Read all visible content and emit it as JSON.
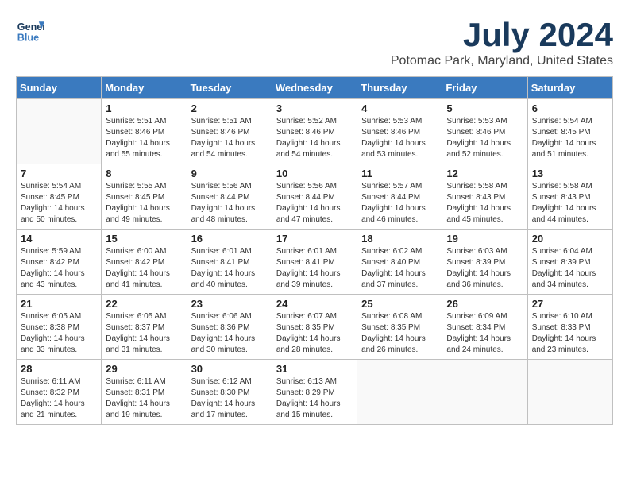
{
  "logo": {
    "line1": "General",
    "line2": "Blue"
  },
  "title": "July 2024",
  "subtitle": "Potomac Park, Maryland, United States",
  "days_of_week": [
    "Sunday",
    "Monday",
    "Tuesday",
    "Wednesday",
    "Thursday",
    "Friday",
    "Saturday"
  ],
  "weeks": [
    [
      {
        "day": "",
        "sunrise": "",
        "sunset": "",
        "daylight": ""
      },
      {
        "day": "1",
        "sunrise": "Sunrise: 5:51 AM",
        "sunset": "Sunset: 8:46 PM",
        "daylight": "Daylight: 14 hours and 55 minutes."
      },
      {
        "day": "2",
        "sunrise": "Sunrise: 5:51 AM",
        "sunset": "Sunset: 8:46 PM",
        "daylight": "Daylight: 14 hours and 54 minutes."
      },
      {
        "day": "3",
        "sunrise": "Sunrise: 5:52 AM",
        "sunset": "Sunset: 8:46 PM",
        "daylight": "Daylight: 14 hours and 54 minutes."
      },
      {
        "day": "4",
        "sunrise": "Sunrise: 5:53 AM",
        "sunset": "Sunset: 8:46 PM",
        "daylight": "Daylight: 14 hours and 53 minutes."
      },
      {
        "day": "5",
        "sunrise": "Sunrise: 5:53 AM",
        "sunset": "Sunset: 8:46 PM",
        "daylight": "Daylight: 14 hours and 52 minutes."
      },
      {
        "day": "6",
        "sunrise": "Sunrise: 5:54 AM",
        "sunset": "Sunset: 8:45 PM",
        "daylight": "Daylight: 14 hours and 51 minutes."
      }
    ],
    [
      {
        "day": "7",
        "sunrise": "Sunrise: 5:54 AM",
        "sunset": "Sunset: 8:45 PM",
        "daylight": "Daylight: 14 hours and 50 minutes."
      },
      {
        "day": "8",
        "sunrise": "Sunrise: 5:55 AM",
        "sunset": "Sunset: 8:45 PM",
        "daylight": "Daylight: 14 hours and 49 minutes."
      },
      {
        "day": "9",
        "sunrise": "Sunrise: 5:56 AM",
        "sunset": "Sunset: 8:44 PM",
        "daylight": "Daylight: 14 hours and 48 minutes."
      },
      {
        "day": "10",
        "sunrise": "Sunrise: 5:56 AM",
        "sunset": "Sunset: 8:44 PM",
        "daylight": "Daylight: 14 hours and 47 minutes."
      },
      {
        "day": "11",
        "sunrise": "Sunrise: 5:57 AM",
        "sunset": "Sunset: 8:44 PM",
        "daylight": "Daylight: 14 hours and 46 minutes."
      },
      {
        "day": "12",
        "sunrise": "Sunrise: 5:58 AM",
        "sunset": "Sunset: 8:43 PM",
        "daylight": "Daylight: 14 hours and 45 minutes."
      },
      {
        "day": "13",
        "sunrise": "Sunrise: 5:58 AM",
        "sunset": "Sunset: 8:43 PM",
        "daylight": "Daylight: 14 hours and 44 minutes."
      }
    ],
    [
      {
        "day": "14",
        "sunrise": "Sunrise: 5:59 AM",
        "sunset": "Sunset: 8:42 PM",
        "daylight": "Daylight: 14 hours and 43 minutes."
      },
      {
        "day": "15",
        "sunrise": "Sunrise: 6:00 AM",
        "sunset": "Sunset: 8:42 PM",
        "daylight": "Daylight: 14 hours and 41 minutes."
      },
      {
        "day": "16",
        "sunrise": "Sunrise: 6:01 AM",
        "sunset": "Sunset: 8:41 PM",
        "daylight": "Daylight: 14 hours and 40 minutes."
      },
      {
        "day": "17",
        "sunrise": "Sunrise: 6:01 AM",
        "sunset": "Sunset: 8:41 PM",
        "daylight": "Daylight: 14 hours and 39 minutes."
      },
      {
        "day": "18",
        "sunrise": "Sunrise: 6:02 AM",
        "sunset": "Sunset: 8:40 PM",
        "daylight": "Daylight: 14 hours and 37 minutes."
      },
      {
        "day": "19",
        "sunrise": "Sunrise: 6:03 AM",
        "sunset": "Sunset: 8:39 PM",
        "daylight": "Daylight: 14 hours and 36 minutes."
      },
      {
        "day": "20",
        "sunrise": "Sunrise: 6:04 AM",
        "sunset": "Sunset: 8:39 PM",
        "daylight": "Daylight: 14 hours and 34 minutes."
      }
    ],
    [
      {
        "day": "21",
        "sunrise": "Sunrise: 6:05 AM",
        "sunset": "Sunset: 8:38 PM",
        "daylight": "Daylight: 14 hours and 33 minutes."
      },
      {
        "day": "22",
        "sunrise": "Sunrise: 6:05 AM",
        "sunset": "Sunset: 8:37 PM",
        "daylight": "Daylight: 14 hours and 31 minutes."
      },
      {
        "day": "23",
        "sunrise": "Sunrise: 6:06 AM",
        "sunset": "Sunset: 8:36 PM",
        "daylight": "Daylight: 14 hours and 30 minutes."
      },
      {
        "day": "24",
        "sunrise": "Sunrise: 6:07 AM",
        "sunset": "Sunset: 8:35 PM",
        "daylight": "Daylight: 14 hours and 28 minutes."
      },
      {
        "day": "25",
        "sunrise": "Sunrise: 6:08 AM",
        "sunset": "Sunset: 8:35 PM",
        "daylight": "Daylight: 14 hours and 26 minutes."
      },
      {
        "day": "26",
        "sunrise": "Sunrise: 6:09 AM",
        "sunset": "Sunset: 8:34 PM",
        "daylight": "Daylight: 14 hours and 24 minutes."
      },
      {
        "day": "27",
        "sunrise": "Sunrise: 6:10 AM",
        "sunset": "Sunset: 8:33 PM",
        "daylight": "Daylight: 14 hours and 23 minutes."
      }
    ],
    [
      {
        "day": "28",
        "sunrise": "Sunrise: 6:11 AM",
        "sunset": "Sunset: 8:32 PM",
        "daylight": "Daylight: 14 hours and 21 minutes."
      },
      {
        "day": "29",
        "sunrise": "Sunrise: 6:11 AM",
        "sunset": "Sunset: 8:31 PM",
        "daylight": "Daylight: 14 hours and 19 minutes."
      },
      {
        "day": "30",
        "sunrise": "Sunrise: 6:12 AM",
        "sunset": "Sunset: 8:30 PM",
        "daylight": "Daylight: 14 hours and 17 minutes."
      },
      {
        "day": "31",
        "sunrise": "Sunrise: 6:13 AM",
        "sunset": "Sunset: 8:29 PM",
        "daylight": "Daylight: 14 hours and 15 minutes."
      },
      {
        "day": "",
        "sunrise": "",
        "sunset": "",
        "daylight": ""
      },
      {
        "day": "",
        "sunrise": "",
        "sunset": "",
        "daylight": ""
      },
      {
        "day": "",
        "sunrise": "",
        "sunset": "",
        "daylight": ""
      }
    ]
  ]
}
